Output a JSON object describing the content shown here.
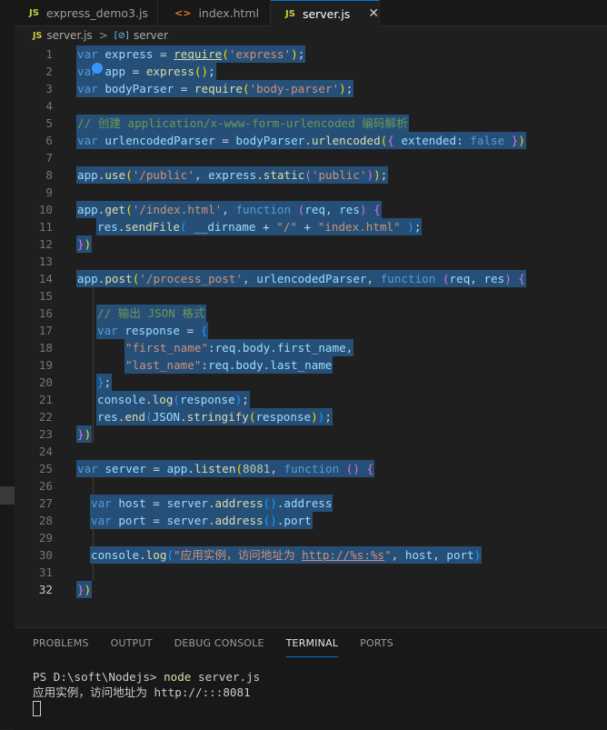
{
  "tabs": [
    {
      "icon": "JS",
      "label": "express_demo3.js",
      "active": false
    },
    {
      "icon": "<>",
      "label": "index.html",
      "active": false
    },
    {
      "icon": "JS",
      "label": "server.js",
      "active": true
    }
  ],
  "close_glyph": "✕",
  "breadcrumb": {
    "file_icon": "JS",
    "file": "server.js",
    "separator": ">",
    "symbol_icon": "[⊘]",
    "symbol": "server"
  },
  "editor": {
    "line_numbers": [
      "1",
      "2",
      "3",
      "4",
      "5",
      "6",
      "7",
      "8",
      "9",
      "10",
      "11",
      "12",
      "13",
      "14",
      "15",
      "16",
      "17",
      "18",
      "19",
      "20",
      "21",
      "22",
      "23",
      "24",
      "25",
      "26",
      "27",
      "28",
      "29",
      "30",
      "31",
      "32"
    ],
    "current_line": "32",
    "code": {
      "l1": {
        "kw": "var",
        "name": "express",
        "eq": " = ",
        "fn": "require",
        "open": "(",
        "str": "'express'",
        "close": ")",
        "end": ";"
      },
      "l2": {
        "kw": "var",
        "name": "app",
        "eq": " = ",
        "fn": "express",
        "call": "()",
        "end": ";"
      },
      "l3": {
        "kw": "var",
        "name": "bodyParser",
        "eq": " = ",
        "fn": "require",
        "open": "(",
        "str": "'body-parser'",
        "close": ")",
        "end": ";"
      },
      "l5": {
        "comment": "// 创建 application/x-www-form-urlencoded 编码解析"
      },
      "l6": {
        "kw": "var",
        "name": "urlencodedParser",
        "eq": " = ",
        "obj": "bodyParser",
        "dot": ".",
        "fn": "urlencoded",
        "open": "(",
        "brace_open": "{",
        "key": " extended",
        "colon": ": ",
        "val": "false",
        "brace_close": " }",
        "close": ")"
      },
      "l8": {
        "obj": "app",
        "dot": ".",
        "fn": "use",
        "open": "(",
        "str": "'/public'",
        "comma": ", ",
        "obj2": "express",
        "dot2": ".",
        "fn2": "static",
        "open2": "(",
        "str2": "'public'",
        "close2": ")",
        "close": ")",
        "end": ";"
      },
      "l10": {
        "obj": "app",
        "dot": ".",
        "fn": "get",
        "open": "(",
        "str": "'/index.html'",
        "comma": ", ",
        "kw": "function",
        "params_open": " (",
        "p1": "req",
        "pc": ", ",
        "p2": "res",
        "params_close": ")",
        "brace": " {"
      },
      "l11": {
        "obj": "res",
        "dot": ".",
        "fn": "sendFile",
        "open": "(",
        "sp": " ",
        "dirname": "__dirname",
        "plus": " + ",
        "str1": "\"/\"",
        "plus2": " + ",
        "str2": "\"index.html\"",
        "close": " )",
        "end": ";"
      },
      "l12": {
        "brace": "}",
        "close": ")"
      },
      "l14": {
        "obj": "app",
        "dot": ".",
        "fn": "post",
        "open": "(",
        "str": "'/process_post'",
        "comma": ", ",
        "arg": "urlencodedParser",
        "comma2": ", ",
        "kw": "function",
        "params_open": " (",
        "p1": "req",
        "pc": ", ",
        "p2": "res",
        "params_close": ")",
        "brace": " {"
      },
      "l16": {
        "comment": "// 输出 JSON 格式"
      },
      "l17": {
        "kw": "var",
        "name": "response",
        "eq": " = ",
        "brace": "{"
      },
      "l18": {
        "key": "\"first_name\"",
        "colon": ":",
        "val": "req.body.first_name",
        "comma": ","
      },
      "l19": {
        "key": "\"last_name\"",
        "colon": ":",
        "val": "req.body.last_name"
      },
      "l20": {
        "brace": "}",
        "end": ";"
      },
      "l21": {
        "obj": "console",
        "dot": ".",
        "fn": "log",
        "open": "(",
        "arg": "response",
        "close": ")",
        "end": ";"
      },
      "l22": {
        "obj": "res",
        "dot": ".",
        "fn": "end",
        "open": "(",
        "obj2": "JSON",
        "dot2": ".",
        "fn2": "stringify",
        "open2": "(",
        "arg": "response",
        "close2": ")",
        "close": ")",
        "end": ";"
      },
      "l23": {
        "brace": "}",
        "close": ")"
      },
      "l25": {
        "kw": "var",
        "name": "server",
        "eq": " = ",
        "obj": "app",
        "dot": ".",
        "fn": "listen",
        "open": "(",
        "num": "8081",
        "comma": ", ",
        "kw2": "function",
        "params": " ()",
        "brace": " {"
      },
      "l27": {
        "kw": "var",
        "name": "host",
        "eq": " = ",
        "obj": "server",
        "dot": ".",
        "fn": "address",
        "call": "()",
        "prop": ".address"
      },
      "l28": {
        "kw": "var",
        "name": "port",
        "eq": " = ",
        "obj": "server",
        "dot": ".",
        "fn": "address",
        "call": "()",
        "prop": ".port"
      },
      "l30": {
        "obj": "console",
        "dot": ".",
        "fn": "log",
        "open": "(",
        "str_a": "\"应用实例，访问地址为 ",
        "str_url": "http://%s:%s",
        "str_b": "\"",
        "comma": ", ",
        "a1": "host",
        "comma2": ", ",
        "a2": "port",
        "close": ")"
      },
      "l32": {
        "brace": "}",
        "close": ")"
      }
    }
  },
  "panel": {
    "tabs": [
      "PROBLEMS",
      "OUTPUT",
      "DEBUG CONSOLE",
      "TERMINAL",
      "PORTS"
    ],
    "active_tab": "TERMINAL",
    "terminal": {
      "prompt": "PS D:\\soft\\Nodejs> ",
      "command": "node",
      "args": " server.js",
      "output": "应用实例，访问地址为 http://:::8081"
    }
  },
  "colors": {
    "accent": "#0078d4",
    "background": "#1f1f1f",
    "selection": "#264f78",
    "keyword": "#569cd6",
    "string": "#ce9178",
    "function": "#dcdcaa",
    "comment": "#6a9955"
  }
}
